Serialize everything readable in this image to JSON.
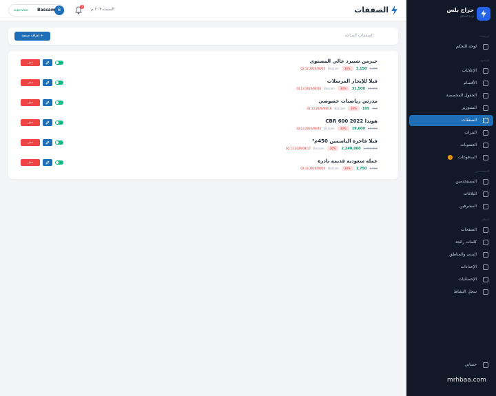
{
  "header": {
    "title": "الصفقات",
    "date_text": "السبت ٢٠٣ م",
    "notification_count": "3",
    "user": {
      "initial": "B",
      "name": "Bassam",
      "role": "supervisor"
    }
  },
  "search": {
    "placeholder": "الصفقات المباحة"
  },
  "add_button": {
    "label": "+ إضافة صفقة"
  },
  "actions": {
    "delete_label": "حذف"
  },
  "deals": [
    {
      "title": "جيرمن شيبرد عالي المستوى",
      "old_price": "5,000",
      "new_price": "3,150",
      "discount": "30%",
      "seller": "Bassam",
      "date": "02.12.2026/08/15"
    },
    {
      "title": "فيلا للإيجار المرسلات",
      "old_price": "45,000",
      "new_price": "31,500",
      "discount": "30%",
      "seller": "Bassam",
      "date": "02.13.2026/08/16"
    },
    {
      "title": "مدرس رياضيات خصوصي",
      "old_price": "150",
      "new_price": "105",
      "discount": "30%",
      "seller": "Bassam",
      "date": "02.13.2026/08/10"
    },
    {
      "title": "هوندا CBR 600 2022",
      "old_price": "28,000",
      "new_price": "19,600",
      "discount": "30%",
      "seller": "Bassam",
      "date": "02.13.2026/08/15"
    },
    {
      "title": "فيلا فاخرة الياسمين 450م²",
      "old_price": "3,000,000",
      "new_price": "2,240,000",
      "discount": "30%",
      "seller": "Bassam",
      "date": "02.13.2026/08/17"
    },
    {
      "title": "عملة سعودية قديمة نادرة",
      "old_price": "2,500",
      "new_price": "1,750",
      "discount": "30%",
      "seller": "Bassam",
      "date": "02.13.2026/08/14"
    }
  ],
  "sidebar": {
    "brand": "حراج بلس",
    "brand_sub": "لوحة التحكم",
    "sections": [
      {
        "title": "الرئيسية",
        "items": [
          {
            "label": "لوحة التحكم"
          }
        ]
      },
      {
        "title": "المحتوى",
        "items": [
          {
            "label": "الإعلانات"
          },
          {
            "label": "الأقسام"
          },
          {
            "label": "الحقول المخصصة"
          },
          {
            "label": "الستوريز"
          },
          {
            "label": "الصفقات"
          },
          {
            "label": "البنرات"
          },
          {
            "label": "العضويات"
          },
          {
            "label": "المدفوعات",
            "badge": "1"
          }
        ]
      },
      {
        "title": "المستخدمين",
        "items": [
          {
            "label": "المستخدمين"
          },
          {
            "label": "البلاغات"
          },
          {
            "label": "المشرفين"
          }
        ]
      },
      {
        "title": "النظام",
        "items": [
          {
            "label": "الصفحات"
          },
          {
            "label": "كلمات رائجة"
          },
          {
            "label": "المدن والمناطق"
          },
          {
            "label": "الإعدادات"
          },
          {
            "label": "الإحصائيات"
          },
          {
            "label": "سجل النشاط"
          }
        ]
      }
    ],
    "footer_item": "حسابي"
  },
  "watermark": "mrhbaa.com",
  "colors": {
    "primary": "#1e6fb8",
    "sidebar_bg": "#111827",
    "danger": "#ef4444",
    "success": "#10b981"
  }
}
